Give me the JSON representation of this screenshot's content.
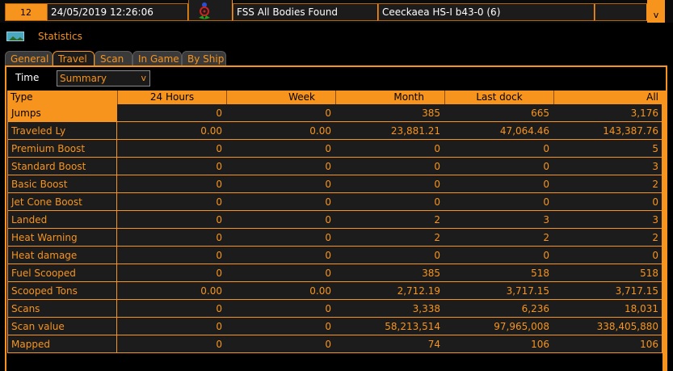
{
  "journal_row": {
    "index": "12",
    "datetime": "24/05/2019 12:26:06",
    "icon": "fss-scan-icon",
    "event": "FSS All Bodies Found",
    "details": "Ceeckaea HS-I b43-0 (6)",
    "scroll_glyph": "v"
  },
  "header": {
    "title": "Statistics",
    "icon": "picture-icon"
  },
  "tabs": [
    {
      "label": "General",
      "active": false
    },
    {
      "label": "Travel",
      "active": true
    },
    {
      "label": "Scan",
      "active": false
    },
    {
      "label": "In Game",
      "active": false
    },
    {
      "label": "By Ship",
      "active": false
    }
  ],
  "time_filter": {
    "label": "Time",
    "value": "Summary",
    "chevron": "v"
  },
  "table": {
    "columns": [
      "Type",
      "24 Hours",
      "Week",
      "Month",
      "Last dock",
      "All"
    ],
    "rows": [
      [
        "Jumps",
        "0",
        "0",
        "385",
        "665",
        "3,176"
      ],
      [
        "Traveled Ly",
        "0.00",
        "0.00",
        "23,881.21",
        "47,064.46",
        "143,387.76"
      ],
      [
        "Premium Boost",
        "0",
        "0",
        "0",
        "0",
        "5"
      ],
      [
        "Standard Boost",
        "0",
        "0",
        "0",
        "0",
        "3"
      ],
      [
        "Basic Boost",
        "0",
        "0",
        "0",
        "0",
        "2"
      ],
      [
        "Jet Cone Boost",
        "0",
        "0",
        "0",
        "0",
        "0"
      ],
      [
        "Landed",
        "0",
        "0",
        "2",
        "3",
        "3"
      ],
      [
        "Heat Warning",
        "0",
        "0",
        "2",
        "2",
        "2"
      ],
      [
        "Heat damage",
        "0",
        "0",
        "0",
        "0",
        "0"
      ],
      [
        "Fuel Scooped",
        "0",
        "0",
        "385",
        "518",
        "518"
      ],
      [
        "Scooped Tons",
        "0.00",
        "0.00",
        "2,712.19",
        "3,717.15",
        "3,717.15"
      ],
      [
        "Scans",
        "0",
        "0",
        "3,338",
        "6,236",
        "18,031"
      ],
      [
        "Scan value",
        "0",
        "0",
        "58,213,514",
        "97,965,008",
        "338,405,880"
      ],
      [
        "Mapped",
        "0",
        "0",
        "74",
        "106",
        "106"
      ]
    ],
    "selected_row": 0
  },
  "colors": {
    "accent": "#f7941d",
    "background": "#000000",
    "cell_bg": "#1c1c1c"
  }
}
